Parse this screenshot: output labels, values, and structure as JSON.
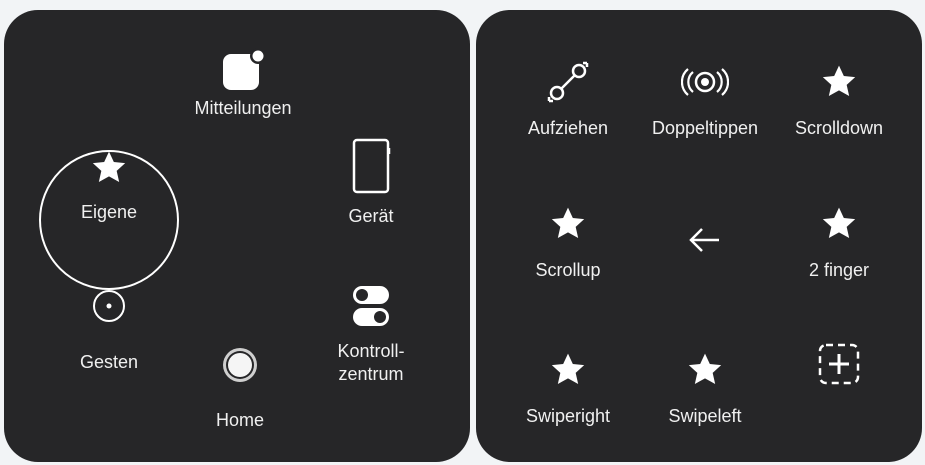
{
  "main_menu": {
    "items": [
      {
        "label": "Mitteilungen",
        "icon": "notification-square-icon"
      },
      {
        "label": "Eigene",
        "icon": "star-icon"
      },
      {
        "label": "Gerät",
        "icon": "device-icon"
      },
      {
        "label": "Gesten",
        "icon": "gesture-dot-icon"
      },
      {
        "label": "Home",
        "icon": "home-button-icon"
      },
      {
        "label": "Kontroll-",
        "label_line2": "zentrum",
        "icon": "toggle-switches-icon"
      }
    ]
  },
  "custom_menu": {
    "items": [
      {
        "label": "Aufziehen",
        "icon": "pinch-expand-icon"
      },
      {
        "label": "Doppeltippen",
        "icon": "double-tap-icon"
      },
      {
        "label": "Scrolldown",
        "icon": "star-icon"
      },
      {
        "label": "Scrollup",
        "icon": "star-icon"
      },
      {
        "label": "",
        "icon": "back-arrow-icon"
      },
      {
        "label": "2 finger",
        "icon": "star-icon"
      },
      {
        "label": "Swiperight",
        "icon": "star-icon"
      },
      {
        "label": "Swipeleft",
        "icon": "star-icon"
      },
      {
        "label": "",
        "icon": "add-custom-icon"
      }
    ]
  },
  "colors": {
    "panel": "#262628",
    "background": "#f2f4f6",
    "foreground": "#ffffff"
  }
}
